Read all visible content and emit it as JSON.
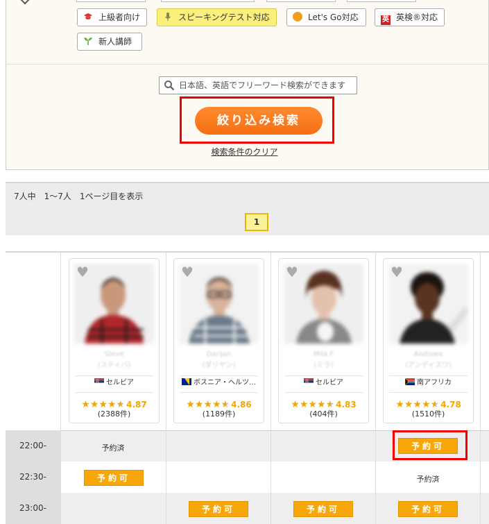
{
  "filters": {
    "tags": [
      {
        "label": "上級者向け",
        "icon": "graduation-cap-icon"
      },
      {
        "label": "スピーキングテスト対応",
        "icon": "microphone-icon"
      },
      {
        "label": "Let's Go対応",
        "icon": "lets-go-badge-icon"
      },
      {
        "label": "英検®対応",
        "icon": "eiken-badge-icon",
        "badge_text": "英"
      },
      {
        "label": "新人講師",
        "icon": "sprout-icon"
      }
    ],
    "search_placeholder": "日本語、英語でフリーワード検索ができます",
    "search_button": "絞り込み検索",
    "clear_link": "検索条件のクリア"
  },
  "results": {
    "summary": "7人中　1〜7人　1ページ目を表示",
    "current_page": "1"
  },
  "teachers": [
    {
      "name": "Steve",
      "kana": "(スティバ)",
      "country": "セルビア",
      "rating": "4.87",
      "rating_value": 4.87,
      "reviews": "(2388件)"
    },
    {
      "name": "Darijan",
      "kana": "(ダリヤン)",
      "country": "ボスニア・ヘルツ…",
      "rating": "4.86",
      "rating_value": 4.86,
      "reviews": "(1189件)"
    },
    {
      "name": "Mila F",
      "kana": "(ミラ)",
      "country": "セルビア",
      "rating": "4.83",
      "rating_value": 4.83,
      "reviews": "(404件)"
    },
    {
      "name": "Andiswa",
      "kana": "(アンディスワ)",
      "country": "南アフリカ",
      "rating": "4.78",
      "rating_value": 4.78,
      "reviews": "(1510件)"
    }
  ],
  "schedule": {
    "book_label": "予約可",
    "booked_label": "予約済",
    "rows": [
      {
        "time": "22:00-",
        "slots": [
          "booked",
          "",
          "",
          "available"
        ]
      },
      {
        "time": "22:30-",
        "slots": [
          "available",
          "",
          "",
          "booked"
        ]
      },
      {
        "time": "23:00-",
        "slots": [
          "",
          "available",
          "available",
          "available"
        ]
      }
    ]
  },
  "colors": {
    "accent_orange": "#f56f14",
    "book_button": "#f7a70a",
    "highlight": "#e00000",
    "star": "#f5a500"
  }
}
